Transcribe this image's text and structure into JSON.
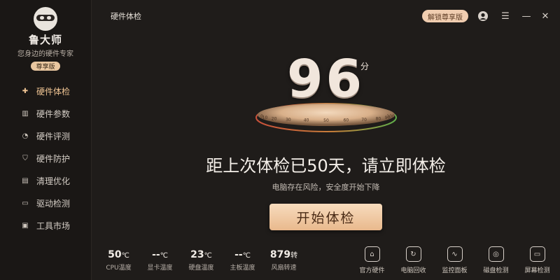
{
  "app": {
    "brand": "鲁大师",
    "slogan": "您身边的硬件专家",
    "edition": "尊享版"
  },
  "sidebar": {
    "items": [
      {
        "label": "硬件体检",
        "icon": "plus-square-icon",
        "active": true
      },
      {
        "label": "硬件参数",
        "icon": "bars-chart-icon",
        "active": false
      },
      {
        "label": "硬件评测",
        "icon": "speedometer-icon",
        "active": false
      },
      {
        "label": "硬件防护",
        "icon": "shield-icon",
        "active": false
      },
      {
        "label": "清理优化",
        "icon": "broom-icon",
        "active": false
      },
      {
        "label": "驱动检测",
        "icon": "drive-icon",
        "active": false
      },
      {
        "label": "工具市场",
        "icon": "toolbox-icon",
        "active": false
      }
    ]
  },
  "header": {
    "title": "硬件体检",
    "unlock_label": "解锁尊享版",
    "controls": [
      "user-icon",
      "menu-icon",
      "minimize-icon",
      "close-icon"
    ]
  },
  "score": {
    "value": "96",
    "unit": "分",
    "scale": [
      "0",
      "10",
      "20",
      "30",
      "40",
      "50",
      "60",
      "70",
      "80",
      "90",
      "100"
    ]
  },
  "main": {
    "headline": "距上次体检已50天，请立即体检",
    "subline": "电脑存在风险，安全度开始下降",
    "start_label": "开始体检"
  },
  "stats": [
    {
      "value": "50",
      "unit": "℃",
      "label": "CPU温度"
    },
    {
      "value": "--",
      "unit": "℃",
      "label": "显卡温度"
    },
    {
      "value": "23",
      "unit": "℃",
      "label": "硬盘温度"
    },
    {
      "value": "--",
      "unit": "℃",
      "label": "主板温度"
    },
    {
      "value": "879",
      "unit": "转",
      "label": "风扇转速"
    }
  ],
  "tools": [
    {
      "label": "官方硬件",
      "icon": "shop-icon"
    },
    {
      "label": "电脑回收",
      "icon": "recycle-icon"
    },
    {
      "label": "监控面板",
      "icon": "monitor-panel-icon"
    },
    {
      "label": "磁盘检测",
      "icon": "disk-icon"
    },
    {
      "label": "屏幕检测",
      "icon": "screen-icon"
    }
  ],
  "colors": {
    "accent": "#f0c594",
    "background": "#1f1c1a",
    "button": "#efc399",
    "gauge_red": "#c9503a",
    "gauge_green": "#5fae4a"
  }
}
